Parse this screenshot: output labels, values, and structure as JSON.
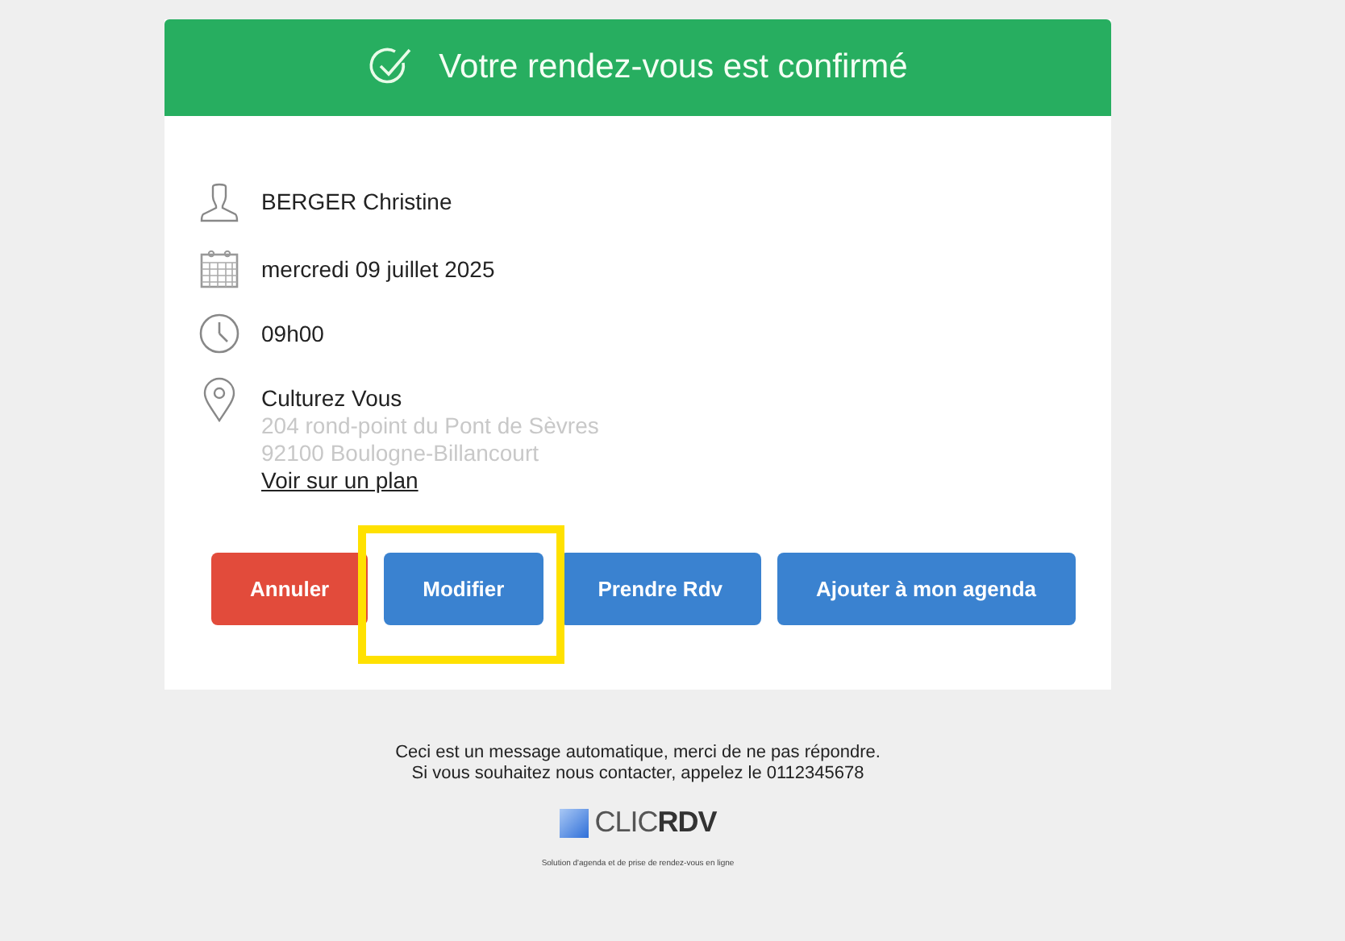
{
  "header": {
    "title": "Votre rendez-vous est confirmé"
  },
  "details": [
    {
      "kind": "person",
      "lines": [
        "BERGER Christine"
      ]
    },
    {
      "kind": "date",
      "lines": [
        "mercredi 09 juillet 2025"
      ]
    },
    {
      "kind": "time",
      "lines": [
        "09h00"
      ]
    },
    {
      "kind": "place",
      "lines": [
        "Culturez Vous"
      ],
      "address": [
        "204 rond-point du Pont de Sèvres",
        "92100 Boulogne-Billancourt"
      ],
      "link": "Voir sur un plan"
    }
  ],
  "buttons": [
    {
      "label": "Annuler",
      "kind": "danger",
      "highlighted": false
    },
    {
      "label": "Modifier",
      "kind": "primary",
      "highlighted": true
    },
    {
      "label": "Prendre Rdv",
      "kind": "primary",
      "highlighted": false
    },
    {
      "label": "Ajouter à mon agenda",
      "kind": "primary",
      "highlighted": false
    }
  ],
  "footer": {
    "notice": [
      "Ceci est un message automatique, merci de ne pas répondre.",
      "Si vous souhaitez nous contacter, appelez le 0112345678"
    ],
    "logo": "CLIC**RDV**",
    "tagline": "Solution d'agenda et de prise de rendez-vous en ligne"
  }
}
